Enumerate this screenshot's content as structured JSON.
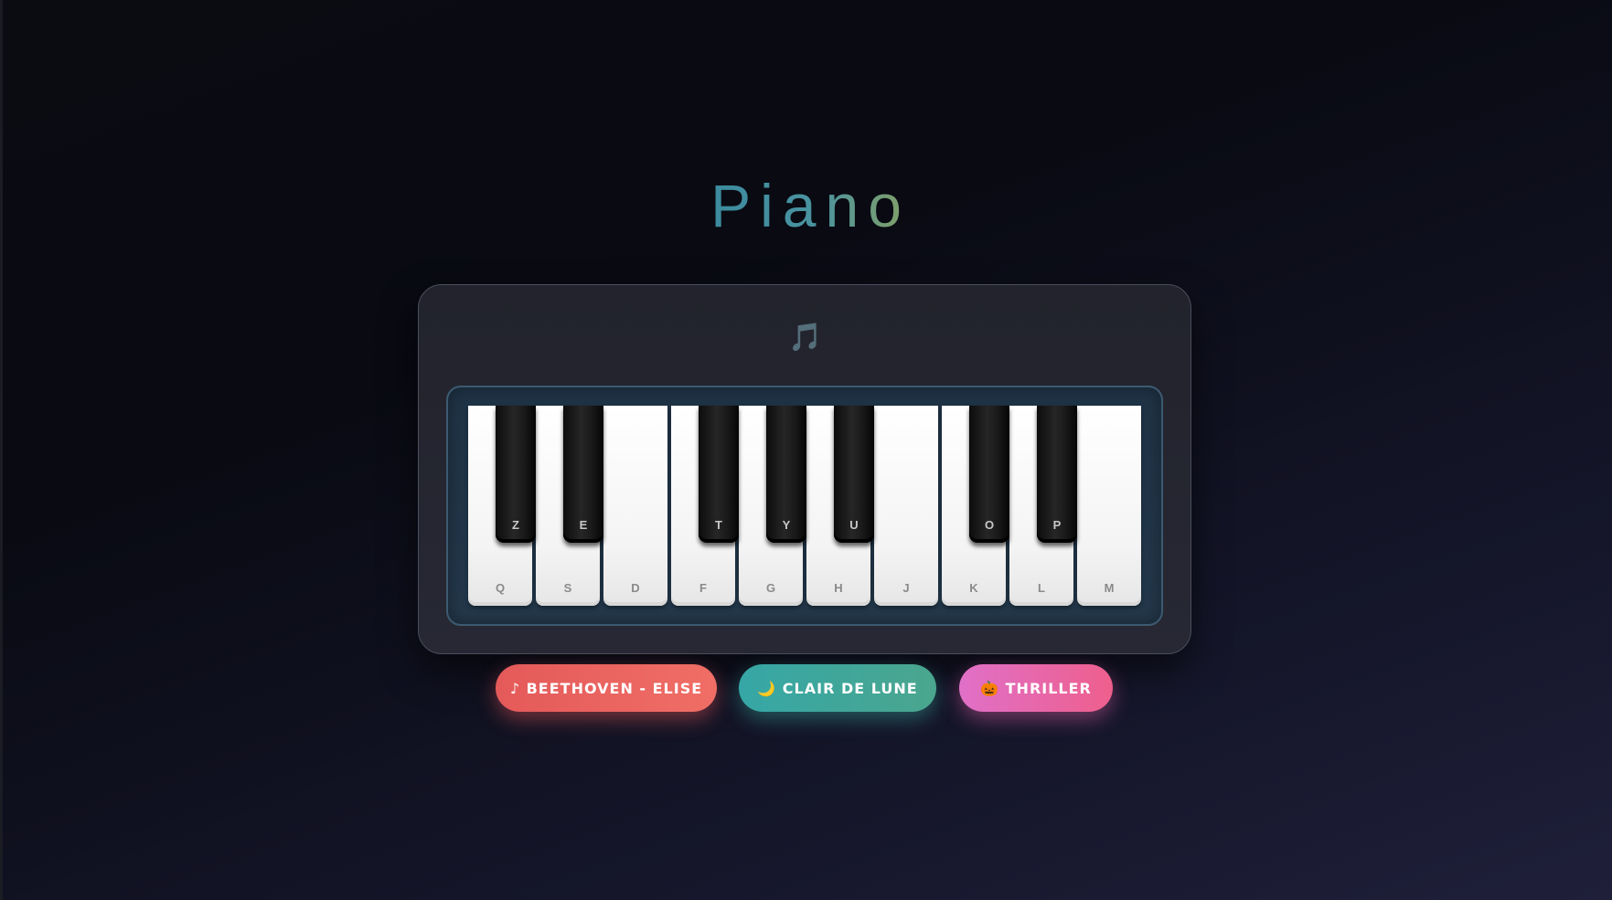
{
  "app": {
    "title": "Piano",
    "status_icon": "music-notes-icon",
    "status_glyph": "🎵"
  },
  "keyboard": {
    "white_keys": [
      {
        "label": "Q"
      },
      {
        "label": "S"
      },
      {
        "label": "D"
      },
      {
        "label": "F"
      },
      {
        "label": "G"
      },
      {
        "label": "H"
      },
      {
        "label": "J"
      },
      {
        "label": "K"
      },
      {
        "label": "L"
      },
      {
        "label": "M"
      }
    ],
    "black_keys": [
      {
        "label": "Z"
      },
      {
        "label": "E"
      },
      {
        "label": "T"
      },
      {
        "label": "Y"
      },
      {
        "label": "U"
      },
      {
        "label": "O"
      },
      {
        "label": "P"
      }
    ]
  },
  "songs": [
    {
      "label": "♪ BEETHOVEN - ELISE",
      "color": "#e85f5c"
    },
    {
      "label": "🌙 CLAIR DE LUNE",
      "color": "#3ea79e"
    },
    {
      "label": "🎃 THRILLER",
      "color": "#e86aa8"
    }
  ]
}
